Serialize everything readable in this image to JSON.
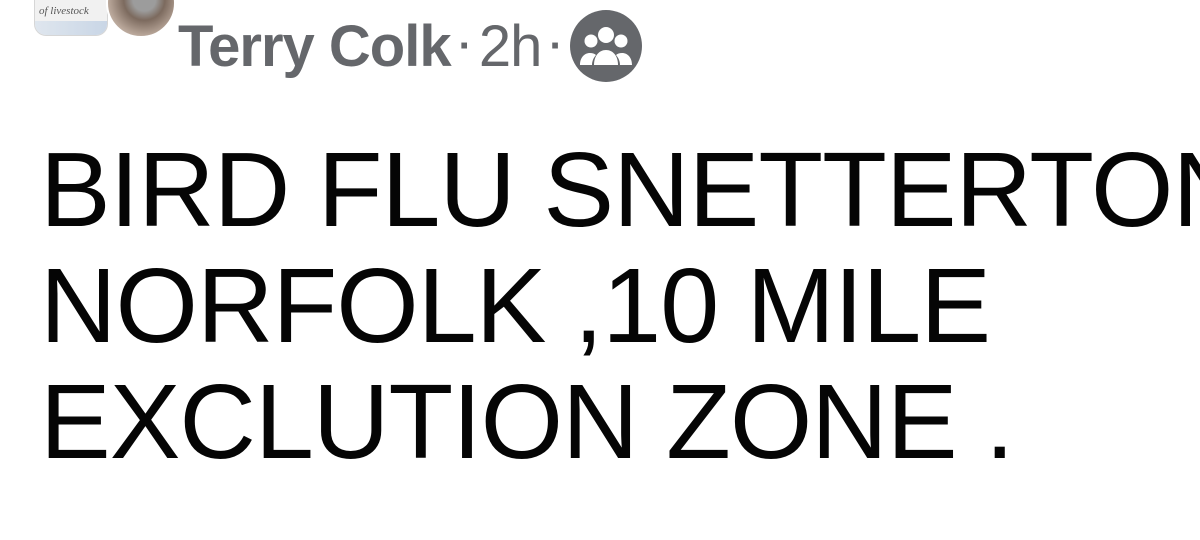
{
  "post": {
    "group_thumbnail_text": "of livestock",
    "author": "Terry Colk",
    "separator": "·",
    "timestamp": "2h",
    "audience_icon": "group-icon",
    "lines": [
      "BIRD FLU SNETTERTON",
      "NORFOLK ,10 MILE",
      "EXCLUTION ZONE ."
    ]
  },
  "colors": {
    "meta_gray": "#65676b",
    "text": "#050505",
    "background": "#ffffff"
  }
}
